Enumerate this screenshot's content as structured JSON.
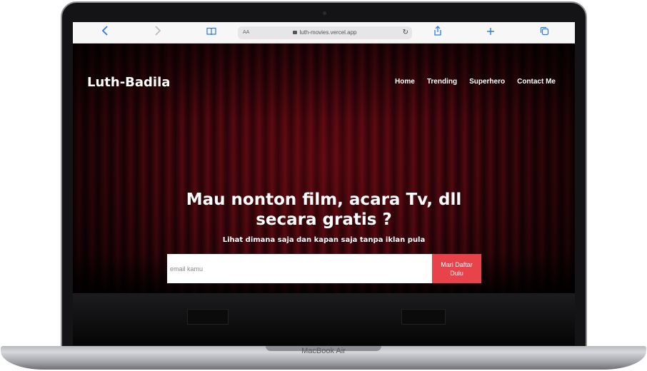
{
  "device": {
    "label": "MacBook Air"
  },
  "browser": {
    "text_size_label": "AA",
    "url": "luth-movies.vercel.app",
    "back_icon": "chevron-left-icon",
    "forward_icon": "chevron-right-icon",
    "bookmarks_icon": "book-icon",
    "reload_icon": "reload-icon",
    "share_icon": "share-icon",
    "new_tab_icon": "plus-icon",
    "tabs_icon": "tabs-icon",
    "accent": "#2b7be6"
  },
  "site": {
    "brand": "Luth-Badila",
    "nav": [
      "Home",
      "Trending",
      "Superhero",
      "Contact Me"
    ],
    "headline_line1": "Mau nonton film, acara Tv, dll",
    "headline_line2": "secara gratis ?",
    "subheadline": "Lihat dimana saja dan kapan saja tanpa iklan pula",
    "email_placeholder": "email kamu",
    "email_value": "",
    "cta_line1": "Mari Daftar",
    "cta_line2": "Dulu",
    "cta_color": "#e8424a"
  }
}
